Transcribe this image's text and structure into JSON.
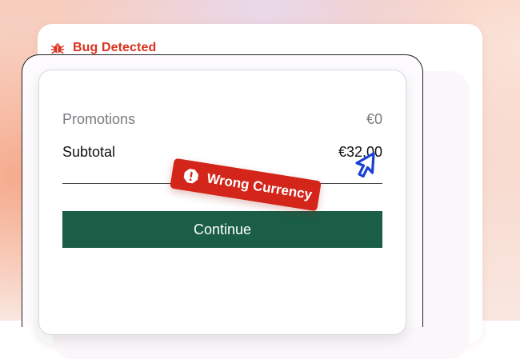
{
  "panel": {
    "title": "Bug Detected",
    "accent_color": "#d9321f",
    "icon": "bug-icon"
  },
  "checkout": {
    "promotions_label": "Promotions",
    "promotions_value": "€0",
    "subtotal_label": "Subtotal",
    "subtotal_value": "€32,00",
    "continue_label": "Continue",
    "button_color": "#1b5e48"
  },
  "annotation": {
    "label": "Wrong Currency",
    "icon": "alert-octagon-icon",
    "color": "#d3251a"
  },
  "pointer": {
    "icon": "cursor-pointer-icon",
    "color": "#1a3fd6"
  }
}
